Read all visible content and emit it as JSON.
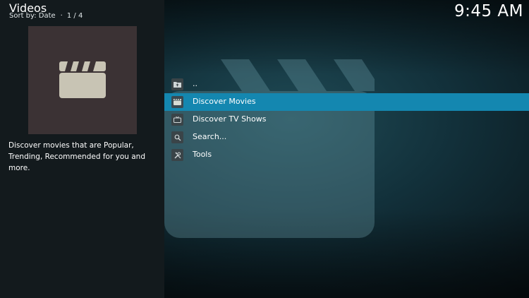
{
  "header": {
    "title": "Videos",
    "sort_label": "Sort by: Date",
    "separator": "·",
    "page": "1 / 4"
  },
  "clock": "9:45 AM",
  "preview": {
    "icon": "clapperboard-icon",
    "description": "Discover movies that are Popular, Trending, Recommended for you and more."
  },
  "menu": {
    "items": [
      {
        "label": "..",
        "icon": "folder-up-icon"
      },
      {
        "label": "Discover Movies",
        "icon": "clapperboard-icon",
        "selected": true
      },
      {
        "label": "Discover TV Shows",
        "icon": "tv-icon"
      },
      {
        "label": "Search...",
        "icon": "search-icon"
      },
      {
        "label": "Tools",
        "icon": "tools-icon"
      }
    ]
  },
  "colors": {
    "selection": "#1487b0",
    "left_panel": "#131a1d",
    "thumb_bg": "#3b3234",
    "clapper": "#c8c4b4"
  }
}
